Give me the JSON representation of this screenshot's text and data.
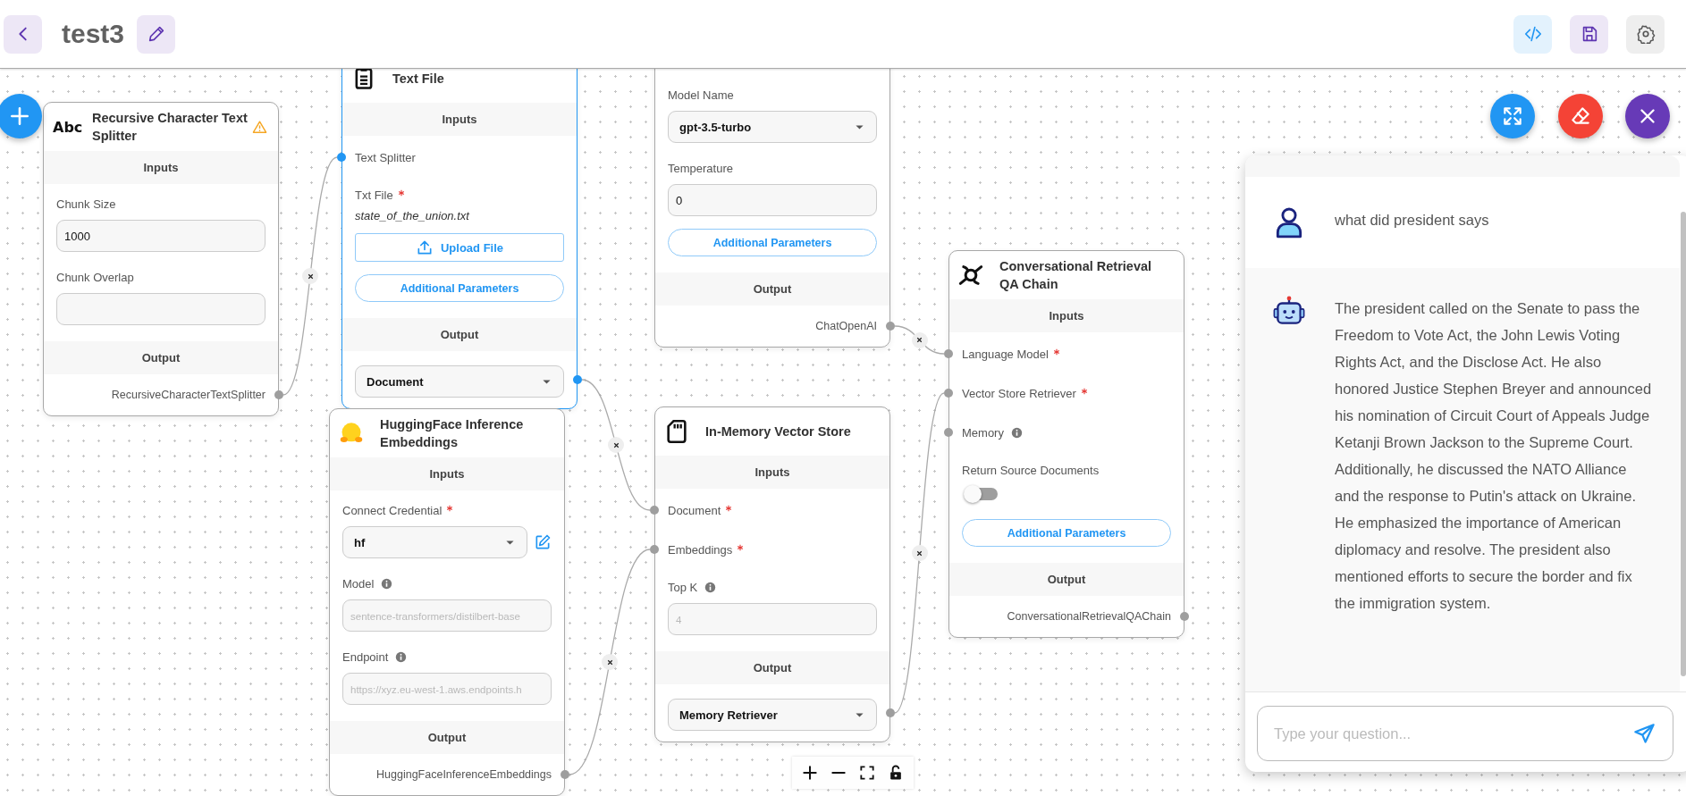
{
  "header": {
    "title": "test3"
  },
  "nodes": [
    {
      "kind": "splitter",
      "icon_text": "Abc",
      "title": "Recursive Character Text Splitter",
      "warning": true,
      "selected": false,
      "inputs_label": "Inputs",
      "inputs": [
        {
          "kind": "text",
          "label": "Chunk Size",
          "value": "1000"
        },
        {
          "kind": "text",
          "label": "Chunk Overlap"
        }
      ],
      "output_label": "Output",
      "output": {
        "kind": "label",
        "value": "RecursiveCharacterTextSplitter"
      }
    },
    {
      "kind": "loader",
      "title": "Text File",
      "selected": true,
      "inputs_label": "Inputs",
      "inputs": [
        {
          "kind": "handle",
          "label": "Text Splitter"
        },
        {
          "kind": "file",
          "label": "Txt File",
          "required": true,
          "file": "state_of_the_union.txt",
          "button": "Upload File"
        },
        {
          "kind": "button",
          "label": "Additional Parameters"
        }
      ],
      "output_label": "Output",
      "output": {
        "kind": "select",
        "value": "Document"
      }
    },
    {
      "selected": false,
      "inputs": [
        {
          "kind": "select",
          "label": "Model Name",
          "value": "gpt-3.5-turbo"
        },
        {
          "kind": "text",
          "label": "Temperature",
          "value": "0"
        },
        {
          "kind": "button",
          "label": "Additional Parameters"
        }
      ],
      "output_label": "Output",
      "output": {
        "kind": "label",
        "value": "ChatOpenAI"
      }
    },
    {
      "kind": "embeddings",
      "title": "HuggingFace Inference Embeddings",
      "selected": false,
      "inputs_label": "Inputs",
      "inputs": [
        {
          "kind": "select",
          "label": "Connect Credential",
          "value": "hf",
          "required": true,
          "edit": true
        },
        {
          "kind": "text",
          "label": "Model",
          "placeholder": "sentence-transformers/distilbert-base",
          "info": true
        },
        {
          "kind": "text",
          "label": "Endpoint",
          "placeholder": "https://xyz.eu-west-1.aws.endpoints.h",
          "info": true
        }
      ],
      "output_label": "Output",
      "output": {
        "kind": "label",
        "value": "HuggingFaceInferenceEmbeddings"
      }
    },
    {
      "kind": "vectorstore",
      "title": "In-Memory Vector Store",
      "selected": false,
      "inputs_label": "Inputs",
      "inputs": [
        {
          "kind": "handle",
          "label": "Document",
          "required": true
        },
        {
          "kind": "handle",
          "label": "Embeddings",
          "required": true
        },
        {
          "kind": "text",
          "label": "Top K",
          "placeholder": "4",
          "info": true
        }
      ],
      "output_label": "Output",
      "output": {
        "kind": "select",
        "value": "Memory Retriever"
      }
    },
    {
      "kind": "chain",
      "title": "Conversational Retrieval QA Chain",
      "selected": false,
      "inputs_label": "Inputs",
      "inputs": [
        {
          "kind": "handle",
          "label": "Language Model",
          "required": true
        },
        {
          "kind": "handle",
          "label": "Vector Store Retriever",
          "required": true
        },
        {
          "kind": "handle",
          "label": "Memory",
          "info": true
        },
        {
          "kind": "toggle",
          "label": "Return Source Documents",
          "on": false
        },
        {
          "kind": "button",
          "label": "Additional Parameters"
        }
      ],
      "output_label": "Output",
      "output": {
        "kind": "label",
        "value": "ConversationalRetrievalQAChain"
      }
    }
  ],
  "chat": {
    "messages": [
      {
        "kind": "user",
        "text": "what did president says"
      },
      {
        "kind": "bot",
        "text": "The president called on the Senate to pass the Freedom to Vote Act, the John Lewis Voting Rights Act, and the Disclose Act. He also honored Justice Stephen Breyer and announced his nomination of Circuit Court of Appeals Judge Ketanji Brown Jackson to the Supreme Court. Additionally, he discussed the NATO Alliance and the response to Putin's attack on Ukraine. He emphasized the importance of American diplomacy and resolve. The president also mentioned efforts to secure the border and fix the immigration system."
      }
    ],
    "input": {
      "placeholder": "Type your question..."
    }
  }
}
